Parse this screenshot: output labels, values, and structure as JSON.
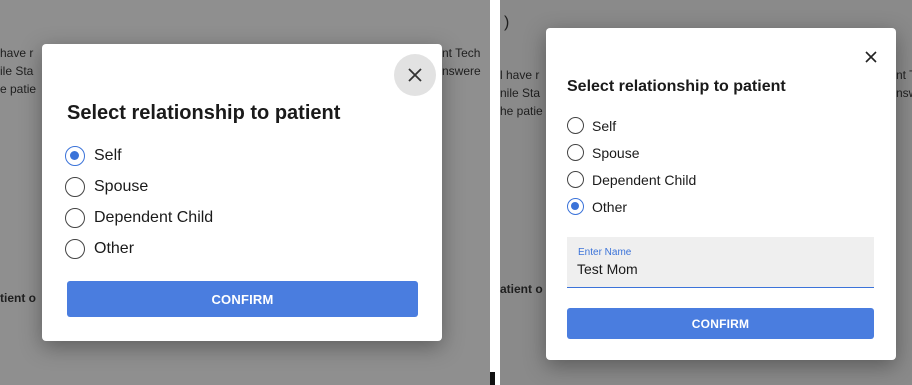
{
  "left_screen": {
    "background_text": {
      "line1": "have r",
      "line2": "ile Sta",
      "line3": "e patie",
      "right1": "nt Tech",
      "right2": "nswere",
      "bottom": "tient o"
    },
    "modal": {
      "title": "Select relationship to patient",
      "options": [
        {
          "label": "Self",
          "selected": true
        },
        {
          "label": "Spouse",
          "selected": false
        },
        {
          "label": "Dependent Child",
          "selected": false
        },
        {
          "label": "Other",
          "selected": false
        }
      ],
      "confirm_label": "CONFIRM"
    }
  },
  "right_screen": {
    "background_text": {
      "top": ")",
      "line1": "l have r",
      "line2": "nile Sta",
      "line3": "he patie",
      "right1": "nt T",
      "right2": "nsw",
      "bottom": "atient o"
    },
    "modal": {
      "title": "Select relationship to patient",
      "options": [
        {
          "label": "Self",
          "selected": false
        },
        {
          "label": "Spouse",
          "selected": false
        },
        {
          "label": "Dependent Child",
          "selected": false
        },
        {
          "label": "Other",
          "selected": true
        }
      ],
      "name_field": {
        "label": "Enter Name",
        "value": "Test Mom"
      },
      "confirm_label": "CONFIRM"
    }
  },
  "colors": {
    "accent": "#3b73d9",
    "button": "#4a7ddf",
    "overlay": "#8f8f8f"
  },
  "icons": {
    "close": "close-icon",
    "radio": "radio-icon"
  }
}
